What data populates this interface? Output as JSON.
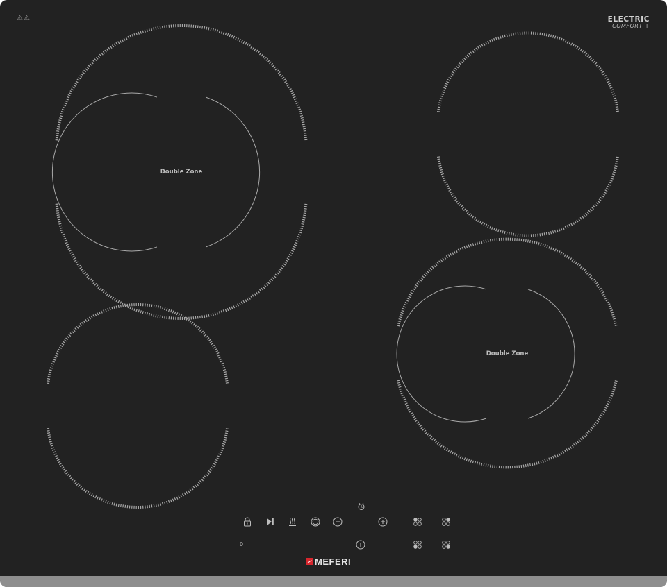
{
  "warning_symbols": "⚠⚠",
  "brand": {
    "type_label": "ELECTRIC",
    "series_label": "COMFORT +"
  },
  "zones": {
    "front_left": {
      "label": "Double Zone"
    },
    "rear_right": {
      "label": "Double Zone"
    }
  },
  "controls": {
    "slider_min_label": "0",
    "icons": [
      "lock-icon",
      "play-pause-icon",
      "heat-icon",
      "zone-ring-icon",
      "minus-icon",
      "timer-icon",
      "plus-icon",
      "info-icon",
      "zone-select-icon"
    ]
  },
  "logo": {
    "text": "MEFERI"
  },
  "colors": {
    "glass": "#222222",
    "frame": "#8e8e8e",
    "lines": "#bdbdbd",
    "logo_red": "#d7262d"
  }
}
